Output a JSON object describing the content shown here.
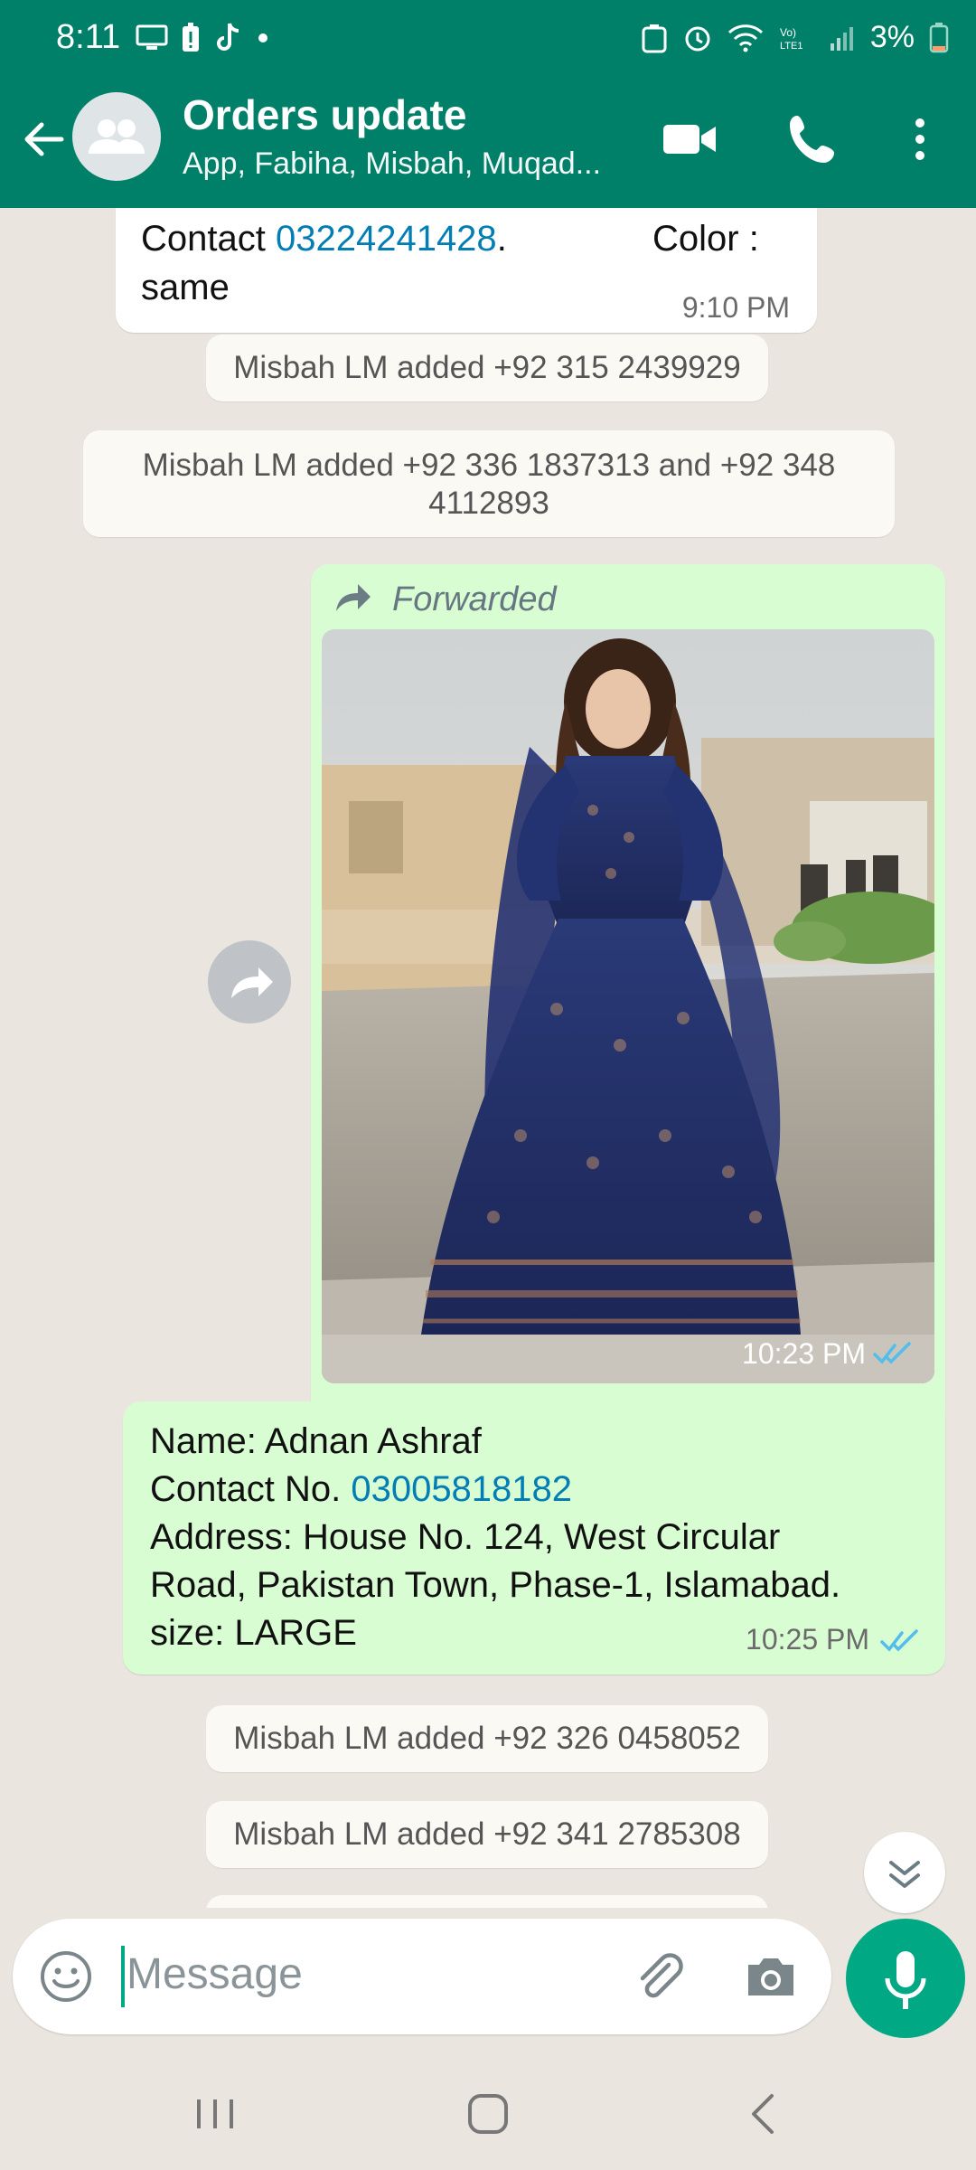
{
  "status_bar": {
    "time": "8:11",
    "battery": "3%"
  },
  "header": {
    "title": "Orders update",
    "subtitle": "App, Fabiha, Misbah, Muqad..."
  },
  "messages": {
    "contact_label": "Contact ",
    "contact_number": "03224241428",
    "contact_tail": ".",
    "color_label": "Color :",
    "same_text": "same",
    "time1": "9:10 PM",
    "system1": "Misbah LM added +92 315 2439929",
    "system2": "Misbah LM added +92 336 1837313 and +92 348 4112893",
    "forwarded_label": "Forwarded",
    "image_time": "10:23 PM",
    "name_line": "Name: Adnan Ashraf",
    "contact_no_label": "Contact No. ",
    "contact_no": "03005818182",
    "address_line1": "Address: House No. 124, West Circular",
    "address_line2": "Road, Pakistan Town, Phase-1, Islamabad.",
    "size_line": "size: LARGE",
    "time2": "10:25 PM",
    "system3": "Misbah LM added +92 326 0458052",
    "system4": "Misbah LM added +92 341 2785308"
  },
  "composer": {
    "placeholder": "Message"
  },
  "colors": {
    "brand": "#008069",
    "accent": "#00a884",
    "outgoing": "#d9fdd3",
    "link": "#027eb5",
    "read_ticks": "#53bdeb"
  }
}
